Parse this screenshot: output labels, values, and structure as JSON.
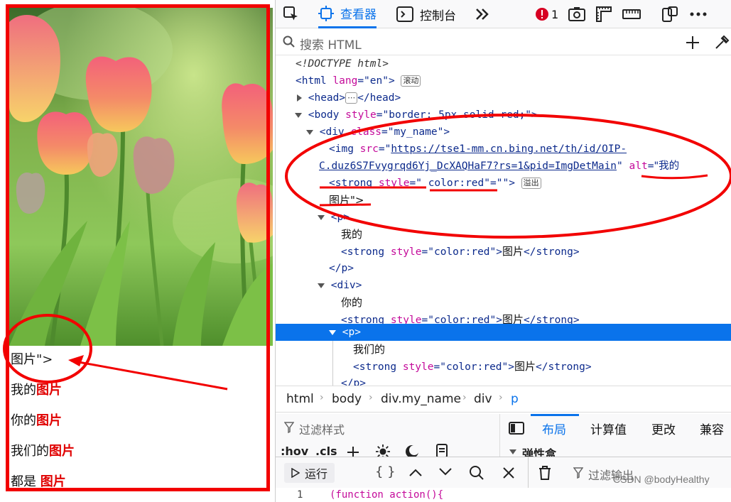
{
  "left_page": {
    "overflow_text": "图片\">",
    "lines": [
      {
        "prefix": "我的",
        "strong": "图片"
      },
      {
        "prefix": "你的",
        "strong": "图片"
      },
      {
        "prefix": "我们的",
        "strong": "图片"
      },
      {
        "prefix": "都是 ",
        "strong": "图片"
      }
    ]
  },
  "toolbar": {
    "inspector_label": "查看器",
    "console_label": "控制台",
    "error_count": "1"
  },
  "search": {
    "placeholder": "搜索 HTML"
  },
  "tree": {
    "doctype": "<!DOCTYPE html>",
    "html_open": "<html",
    "html_lang_attr": " lang",
    "html_lang_val": "\"en\"",
    "html_close_bracket": ">",
    "scroll_badge": "滚动",
    "head_open": "<head>",
    "head_close": "</head>",
    "ellipsis": "⋯",
    "body_open": "<body",
    "body_style_attr": " style",
    "body_style_val": "\"border: 5px solid red;\"",
    "gt": ">",
    "div_open": "<div",
    "div_class_attr": " class",
    "div_class_val": "\"my_name\"",
    "img_open": "<img",
    "img_src_attr": " src",
    "img_src_q": "\"",
    "img_src_url1": "https://tse1-mm.cn.bing.net/th/id/OIP-",
    "img_src_url2": "C.duz6S7Fvygrqd6Yj_DcXAQHaF7?rs=1&pid=ImgDetMain",
    "img_alt_attr": "alt",
    "img_alt_val": "\"我的",
    "strong_open": "<strong",
    "strong_style_attr": " style",
    "strong_style_val": "=\" color:red\"",
    "strong_tail": "=\"\">",
    "overflow_badge": "溢出",
    "img_tail_text": "图片\">",
    "p_open": "<p>",
    "p_close": "</p>",
    "div2_open": "<div>",
    "text_wode": "我的",
    "text_nide": "你的",
    "text_women": "我们的",
    "strong_line_open": "<strong",
    "strong_line_attr": " style",
    "strong_line_val": "\"color:red\"",
    "strong_line_text": "图片",
    "strong_close": "</strong>",
    "truncated_close": "</p>"
  },
  "breadcrumb": [
    "html",
    "body",
    "div.my_name",
    "div",
    "p"
  ],
  "rules_panel": {
    "filter_placeholder": "过滤样式",
    "pseudo": ":hov",
    "cls": ".cls"
  },
  "layout_panel": {
    "tabs": [
      "布局",
      "计算值",
      "更改",
      "兼容"
    ],
    "flex_section": "弹性盒"
  },
  "console": {
    "run_label": "运行",
    "filter_output": "过滤输出",
    "line_no": "1",
    "code": "(function action(){"
  },
  "watermark": "CSDN @bodyHealthy",
  "colors": {
    "accent": "#0a73eb",
    "annotation_red": "#f20000",
    "tag_blue": "#0c2a8c",
    "attr_magenta": "#c40a9a"
  }
}
